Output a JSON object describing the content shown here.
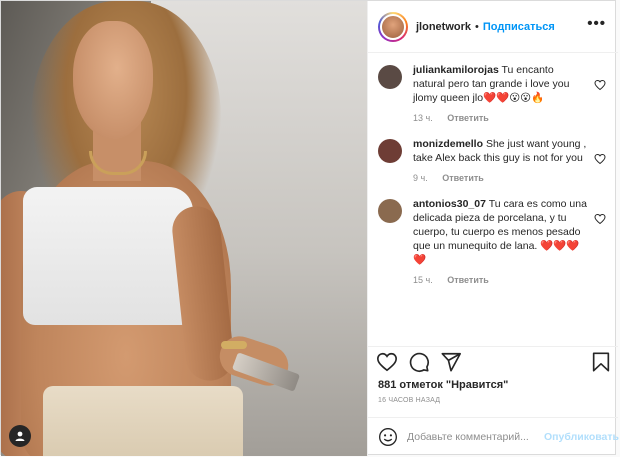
{
  "post": {
    "author": "jlonetwork",
    "separator": "•",
    "follow_label": "Подписаться",
    "more_label": "•••"
  },
  "comments": [
    {
      "username": "juliankamilorojas",
      "text": "Tu encanto natural pero tan grande i love you jlomy queen jlo",
      "emoji": "❤️❤️😮😮🔥",
      "time": "13 ч.",
      "reply_label": "Ответить",
      "avatar_color": "#5a4a44"
    },
    {
      "username": "monizdemello",
      "text": "She just want young , take Alex back this guy is not for you",
      "emoji": "",
      "time": "9 ч.",
      "reply_label": "Ответить",
      "avatar_color": "#6e3d35"
    },
    {
      "username": "antonios30_07",
      "text": "Tu cara es como una delicada pieza de porcelana, y tu cuerpo, tu cuerpo es menos pesado que un munequito de lana.",
      "emoji": "❤️❤️❤️❤️",
      "time": "15 ч.",
      "reply_label": "Ответить",
      "avatar_color": "#8a6a4f"
    }
  ],
  "actions": {
    "icons": [
      "heart-icon",
      "comment-icon",
      "share-icon",
      "bookmark-icon"
    ]
  },
  "likes_text": "881 отметок \"Нравится\"",
  "timestamp": "16 часов назад",
  "comment_box": {
    "placeholder": "Добавьте комментарий...",
    "publish_label": "Опубликовать"
  },
  "colors": {
    "link": "#0095f6",
    "publish_disabled": "#b2dffc",
    "muted": "#8e8e8e"
  }
}
